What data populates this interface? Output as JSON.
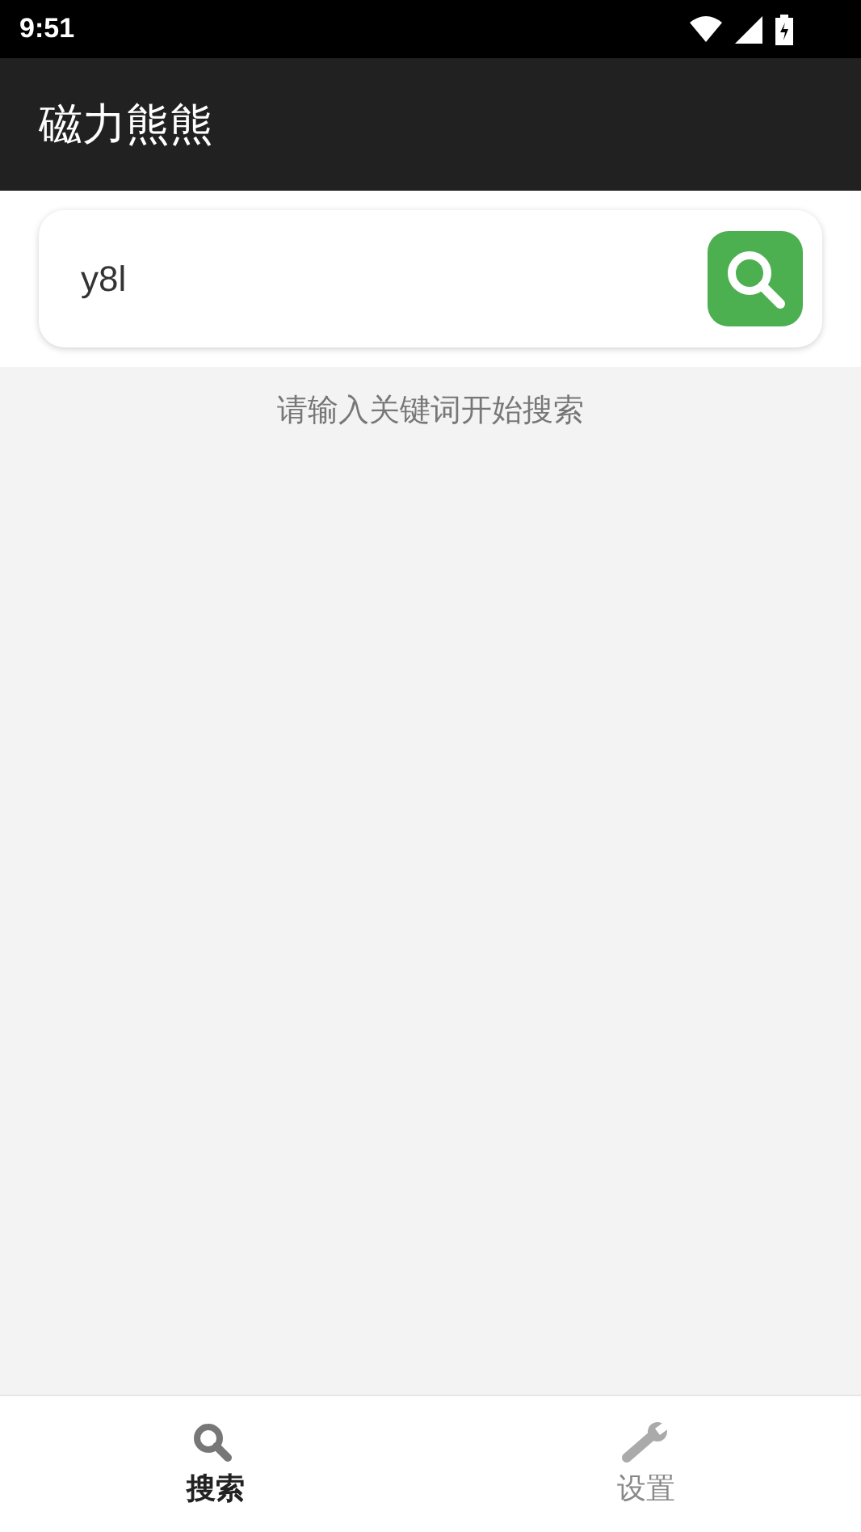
{
  "status_bar": {
    "time": "9:51"
  },
  "app_bar": {
    "title": "磁力熊熊"
  },
  "search": {
    "value": "y8l"
  },
  "hint": "请输入关键词开始搜索",
  "tabs": [
    {
      "label": "搜索",
      "kind": "search",
      "selected": true
    },
    {
      "label": "设置",
      "kind": "settings",
      "selected": false
    }
  ]
}
